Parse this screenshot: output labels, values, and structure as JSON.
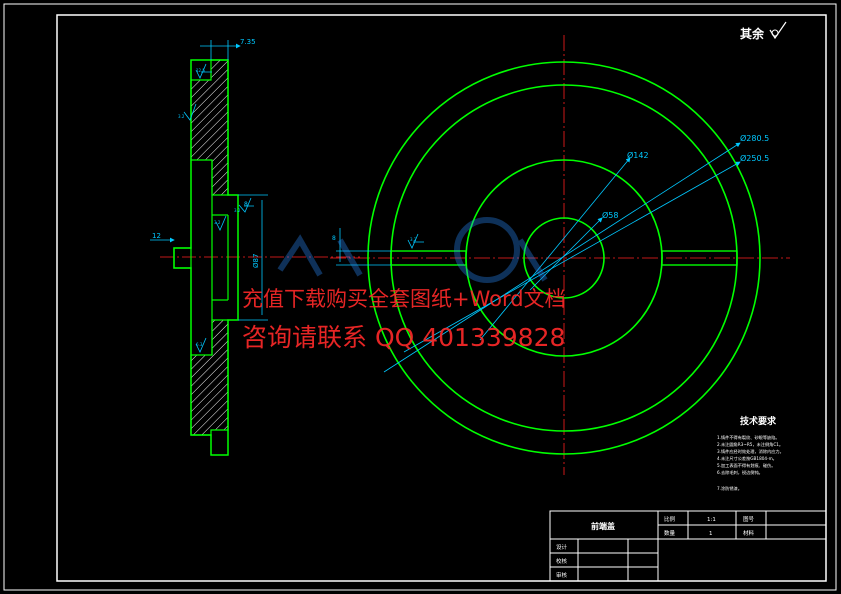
{
  "roughness_note": "其余",
  "section_view": {
    "dim_top": "7.35",
    "dim_left": "12",
    "dim_bore": "Ø87",
    "dim_small_8": "8",
    "roughness_marks": [
      "12.5",
      "3.2",
      "3.2",
      "6.3",
      "3.2"
    ]
  },
  "front_view": {
    "dim_d1": "Ø280.5",
    "dim_d2": "Ø250.5",
    "dim_d3": "Ø142",
    "dim_d4": "Ø58",
    "dim_keyway": "8",
    "keyway_mark": "3.2"
  },
  "tech_requirements": {
    "title": "技术要求",
    "lines": [
      "1.铸件不得有裂纹、砂眼等缺陷。",
      "2.未注圆角R3~R5，未注倒角C1。",
      "3.铸件应经时效处理，消除内应力。",
      "4.未注尺寸公差按GB1804-m。",
      "5.加工表面不得有划痕、碰伤。",
      "6.去除毛刺，锐边倒钝。",
      "7.涂防锈漆。"
    ]
  },
  "title_block": {
    "part_name": "前端盖",
    "scale_label": "比例",
    "scale_value": "1:1",
    "qty_label": "数量",
    "qty_value": "1",
    "drawing_no_label": "图号",
    "material_label": "材料",
    "designer_label": "设计",
    "checker_label": "校核",
    "approver_label": "审核"
  },
  "watermark": {
    "line1": "充值下载购买全套图纸+Word文档",
    "line2": "咨询请联系  QQ 401339828"
  },
  "colors": {
    "outline": "#00ff00",
    "centerline": "#ff2020",
    "dimension": "#00c8ff",
    "frame": "#ffffff",
    "watermark": "#ff2a2a"
  }
}
